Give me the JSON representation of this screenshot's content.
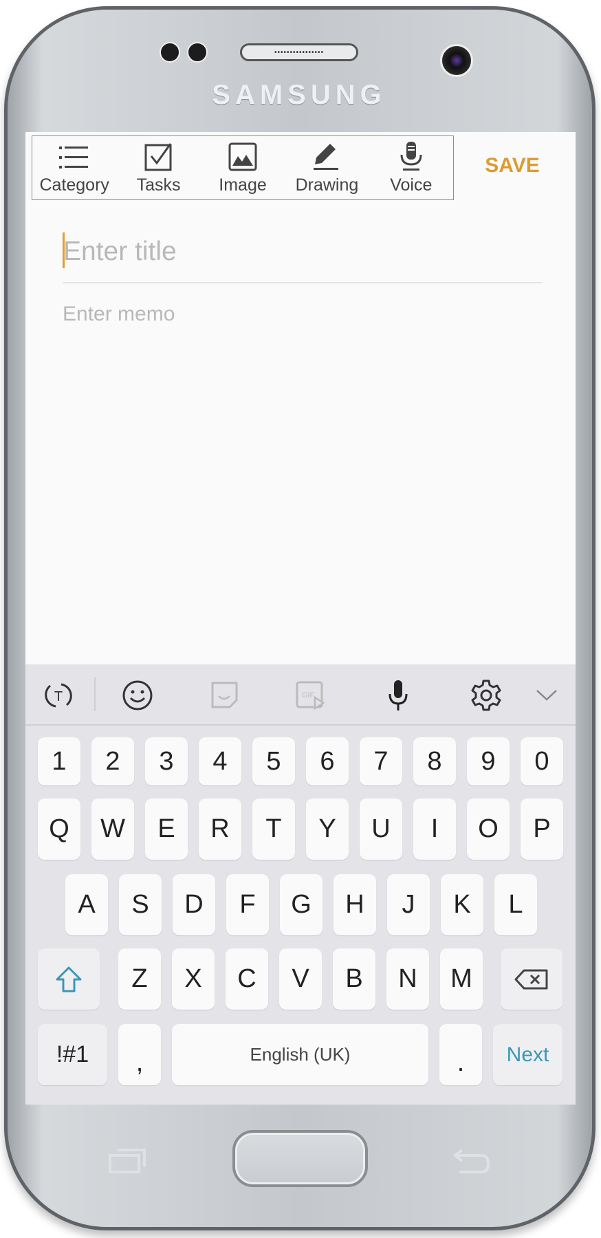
{
  "device": {
    "brand": "SAMSUNG"
  },
  "toolbar": {
    "items": [
      {
        "label": "Category",
        "icon": "list-icon"
      },
      {
        "label": "Tasks",
        "icon": "checkbox-icon"
      },
      {
        "label": "Image",
        "icon": "image-icon"
      },
      {
        "label": "Drawing",
        "icon": "pencil-icon"
      },
      {
        "label": "Voice",
        "icon": "microphone-icon"
      }
    ],
    "save_label": "SAVE"
  },
  "note": {
    "title_placeholder": "Enter title",
    "memo_placeholder": "Enter memo"
  },
  "keyboard": {
    "toolbar_icons": [
      "text-mode-icon",
      "emoji-icon",
      "sticker-icon",
      "gif-icon",
      "microphone-icon",
      "gear-icon",
      "chevron-down-icon"
    ],
    "rows": [
      [
        "1",
        "2",
        "3",
        "4",
        "5",
        "6",
        "7",
        "8",
        "9",
        "0"
      ],
      [
        "Q",
        "W",
        "E",
        "R",
        "T",
        "Y",
        "U",
        "I",
        "O",
        "P"
      ],
      [
        "A",
        "S",
        "D",
        "F",
        "G",
        "H",
        "J",
        "K",
        "L"
      ],
      [
        "Z",
        "X",
        "C",
        "V",
        "B",
        "N",
        "M"
      ]
    ],
    "symbols_label": "!#1",
    "comma": ",",
    "space_label": "English (UK)",
    "period": ".",
    "next_label": "Next"
  },
  "colors": {
    "accent": "#dd9b2e",
    "next": "#3a97b8"
  }
}
